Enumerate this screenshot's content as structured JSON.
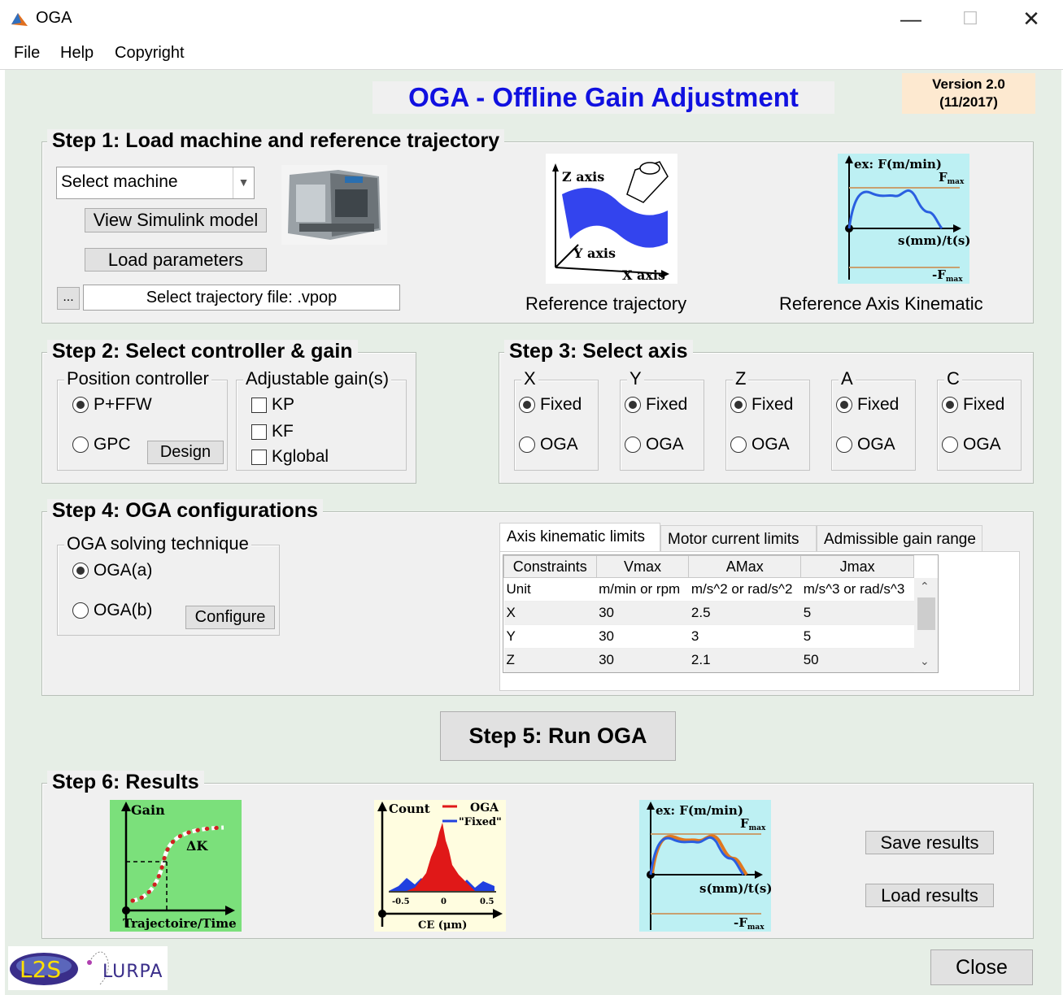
{
  "window": {
    "title": "OGA",
    "minimize_glyph": "—",
    "maximize_glyph": "☐",
    "close_glyph": "✕"
  },
  "menu": [
    "File",
    "Help",
    "Copyright"
  ],
  "header": {
    "title": "OGA - Offline Gain Adjustment",
    "title_color": "#1010e0",
    "version_line1": "Version 2.0",
    "version_line2": "(11/2017)",
    "version_bg": "#fde9d0"
  },
  "step1": {
    "title": "Step 1: Load machine and reference trajectory",
    "machine_select_value": "Select machine",
    "view_simulink": "View Simulink model",
    "load_parameters": "Load parameters",
    "browse_label": "...",
    "trajectory_file": "Select trajectory file: .vpop",
    "ref_traj_caption": "Reference trajectory",
    "ref_traj_labels": {
      "z": "Z axis",
      "y": "Y axis",
      "x": "X axis"
    },
    "ref_kin_caption": "Reference Axis Kinematic",
    "ref_kin_labels": {
      "y": "ex: F(m/min)",
      "fmax": "F",
      "fmax_sub": "max",
      "x": "s(mm)/t(s)",
      "fmin": "-F",
      "fmin_sub": "max"
    }
  },
  "step2": {
    "title": "Step 2: Select controller & gain",
    "pos_group": "Position controller",
    "radio_pffw": "P+FFW",
    "radio_gpc": "GPC",
    "design": "Design",
    "gain_group": "Adjustable gain(s)",
    "gains": [
      "KP",
      "KF",
      "Kglobal"
    ]
  },
  "step3": {
    "title": "Step 3: Select axis",
    "axes": [
      {
        "name": "X",
        "fixed": "Fixed",
        "oga": "OGA"
      },
      {
        "name": "Y",
        "fixed": "Fixed",
        "oga": "OGA"
      },
      {
        "name": "Z",
        "fixed": "Fixed",
        "oga": "OGA"
      },
      {
        "name": "A",
        "fixed": "Fixed",
        "oga": "OGA"
      },
      {
        "name": "C",
        "fixed": "Fixed",
        "oga": "OGA"
      }
    ]
  },
  "step4": {
    "title": "Step 4: OGA configurations",
    "group": "OGA solving technique",
    "radio_a": "OGA(a)",
    "radio_b": "OGA(b)",
    "configure": "Configure",
    "tabs": [
      "Axis kinematic limits",
      "Motor current limits",
      "Admissible gain range"
    ],
    "columns": [
      "Constraints",
      "Vmax",
      "AMax",
      "Jmax"
    ],
    "rows": [
      [
        "Unit",
        "m/min or rpm",
        "m/s^2 or rad/s^2",
        "m/s^3 or rad/s^3"
      ],
      [
        "X",
        "30",
        "2.5",
        "5"
      ],
      [
        "Y",
        "30",
        "3",
        "5"
      ],
      [
        "Z",
        "30",
        "2.1",
        "50"
      ]
    ]
  },
  "step5": {
    "run": "Step 5: Run OGA"
  },
  "step6": {
    "title": "Step 6: Results",
    "gain_plot": {
      "y": "Gain",
      "dk": "ΔK",
      "x": "Trajectoire/Time"
    },
    "hist_plot": {
      "y": "Count",
      "legend_oga": "OGA",
      "legend_fixed": "\"Fixed\"",
      "x": "CE (μm)",
      "ticks": [
        "-0.5",
        "0",
        "0.5"
      ]
    },
    "kin_plot": {
      "y": "ex: F(m/min)",
      "fmax": "F",
      "fmax_sub": "max",
      "x": "s(mm)/t(s)",
      "fmin": "-F",
      "fmin_sub": "max"
    },
    "save": "Save results",
    "load": "Load results"
  },
  "footer": {
    "logo_l2s": "L2S",
    "logo_lurpa": "LURPA",
    "close": "Close"
  }
}
